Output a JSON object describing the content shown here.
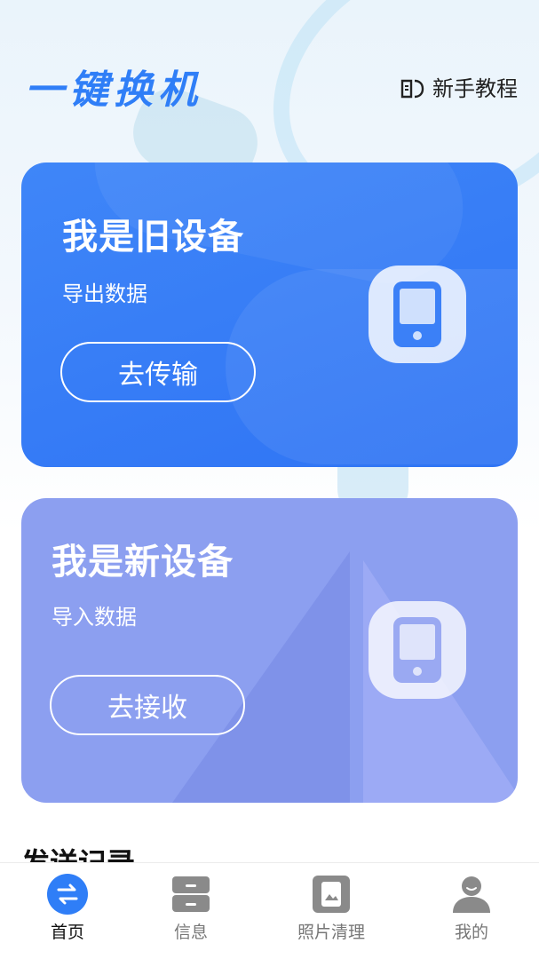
{
  "header": {
    "app_title": "一键换机",
    "tutorial_label": "新手教程"
  },
  "old_device_card": {
    "title": "我是旧设备",
    "subtitle": "导出数据",
    "button_label": "去传输",
    "color": "#3a7ff7"
  },
  "new_device_card": {
    "title": "我是新设备",
    "subtitle": "导入数据",
    "button_label": "去接收",
    "color": "#8c9ff0"
  },
  "section": {
    "heading": "发送记录"
  },
  "tabbar": {
    "tabs": [
      {
        "label": "首页",
        "icon": "transfer-icon",
        "active": true
      },
      {
        "label": "信息",
        "icon": "drawer-icon",
        "active": false
      },
      {
        "label": "照片清理",
        "icon": "photo-clean-icon",
        "active": false
      },
      {
        "label": "我的",
        "icon": "profile-icon",
        "active": false
      }
    ],
    "active_color": "#2f7ef7",
    "inactive_color": "#888888"
  }
}
